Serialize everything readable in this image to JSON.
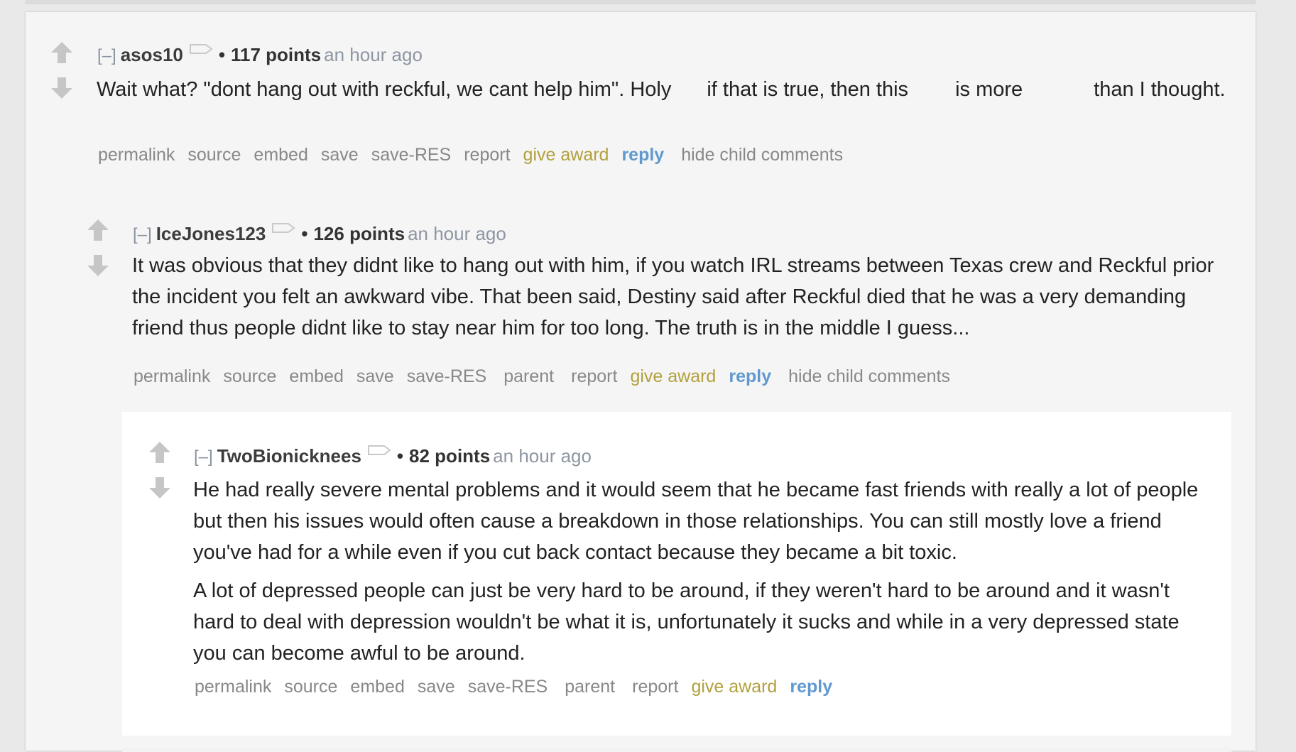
{
  "colors": {
    "background": "#e9e9e9",
    "thread_bg": "#f5f5f5",
    "nested_bg": "#ffffff",
    "award": "#b2a03d",
    "reply": "#5f99cf",
    "muted": "#888888"
  },
  "icons": {
    "upvote": "upvote-arrow-icon",
    "downvote": "downvote-arrow-icon",
    "flair": "flair-tag-icon"
  },
  "comments": [
    {
      "collapse": "[–]",
      "author": "asos10",
      "bullet": "•",
      "points": "117 points",
      "time": "an hour ago",
      "body": {
        "s1": "Wait what? \"dont hang out with reckful, we cant help him\". Holy",
        "s2": "if that is true, then this",
        "s3": "is more",
        "s4": "than I thought."
      },
      "actions": {
        "permalink": "permalink",
        "source": "source",
        "embed": "embed",
        "save": "save",
        "save_res": "save-RES",
        "report": "report",
        "give_award": "give award",
        "reply": "reply",
        "hide_children": "hide child comments"
      }
    },
    {
      "collapse": "[–]",
      "author": "IceJones123",
      "bullet": "•",
      "points": "126 points",
      "time": "an hour ago",
      "body": {
        "p1": "It was obvious that they didnt like to hang out with him, if you watch IRL streams between Texas crew and Reckful prior the incident you felt an awkward vibe. That been said, Destiny said after Reckful died that he was a very demanding friend thus people didnt like to stay near him for too long. The truth is in the middle I guess..."
      },
      "actions": {
        "permalink": "permalink",
        "source": "source",
        "embed": "embed",
        "save": "save",
        "save_res": "save-RES",
        "parent": "parent",
        "report": "report",
        "give_award": "give award",
        "reply": "reply",
        "hide_children": "hide child comments"
      }
    },
    {
      "collapse": "[–]",
      "author": "TwoBionicknees",
      "bullet": "•",
      "points": "82 points",
      "time": "an hour ago",
      "body": {
        "p1": "He had really severe mental problems and it would seem that he became fast friends with really a lot of people but then his issues would often cause a breakdown in those relationships. You can still mostly love a friend you've had for a while even if you cut back contact because they became a bit toxic.",
        "p2": "A lot of depressed people can just be very hard to be around, if they weren't hard to be around and it wasn't hard to deal with depression wouldn't be what it is, unfortunately it sucks and while in a very depressed state you can become awful to be around."
      },
      "actions": {
        "permalink": "permalink",
        "source": "source",
        "embed": "embed",
        "save": "save",
        "save_res": "save-RES",
        "parent": "parent",
        "report": "report",
        "give_award": "give award",
        "reply": "reply"
      }
    }
  ]
}
